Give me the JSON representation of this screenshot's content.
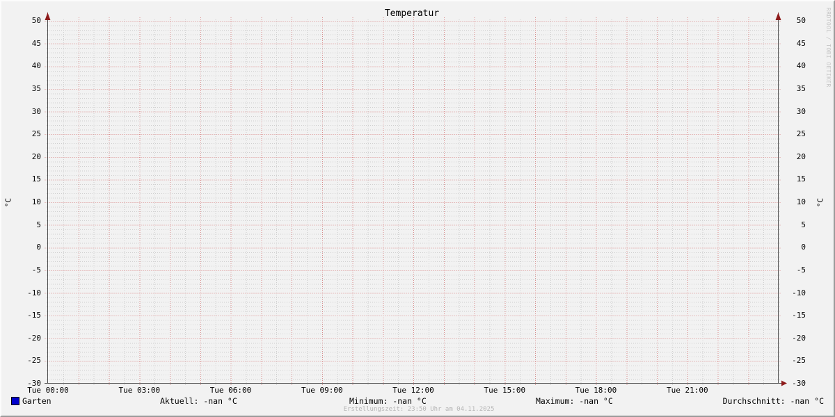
{
  "title": "Temperatur",
  "colors": {
    "background": "#f2f2f2",
    "grid_minor": "#cfcfcf",
    "grid_major": "#d98c8c",
    "axis": "#4e4e4e",
    "arrow": "#8e1b1b",
    "series_garten": "#0000cc",
    "text": "#000000",
    "footer_text": "#b5b5b5",
    "watermark_text": "#c5c5c5"
  },
  "chart_data": {
    "type": "line",
    "title": "Temperatur",
    "ylabel_left": "°C",
    "ylabel_right": "°C",
    "ylim": [
      -30,
      50
    ],
    "y_major_step": 5,
    "y_minor_step": 1,
    "x_hours": 24,
    "x_major_step_hours": 1,
    "x_minor_step_hours": 0.5,
    "grid": true,
    "legend_position": "bottom",
    "y_ticks": [
      {
        "value": 50,
        "label": "50"
      },
      {
        "value": 45,
        "label": "45"
      },
      {
        "value": 40,
        "label": "40"
      },
      {
        "value": 35,
        "label": "35"
      },
      {
        "value": 30,
        "label": "30"
      },
      {
        "value": 25,
        "label": "25"
      },
      {
        "value": 20,
        "label": "20"
      },
      {
        "value": 15,
        "label": "15"
      },
      {
        "value": 10,
        "label": "10"
      },
      {
        "value": 5,
        "label": "5"
      },
      {
        "value": 0,
        "label": "0"
      },
      {
        "value": -5,
        "label": "-5"
      },
      {
        "value": -10,
        "label": "-10"
      },
      {
        "value": -15,
        "label": "-15"
      },
      {
        "value": -20,
        "label": "-20"
      },
      {
        "value": -25,
        "label": "-25"
      },
      {
        "value": -30,
        "label": "-30"
      }
    ],
    "x_ticks": [
      {
        "hour": 0,
        "label": "Tue 00:00"
      },
      {
        "hour": 3,
        "label": "Tue 03:00"
      },
      {
        "hour": 6,
        "label": "Tue 06:00"
      },
      {
        "hour": 9,
        "label": "Tue 09:00"
      },
      {
        "hour": 12,
        "label": "Tue 12:00"
      },
      {
        "hour": 15,
        "label": "Tue 15:00"
      },
      {
        "hour": 18,
        "label": "Tue 18:00"
      },
      {
        "hour": 21,
        "label": "Tue 21:00"
      }
    ],
    "series": [
      {
        "name": "Garten",
        "color": "#0000cc",
        "values": [],
        "note": "no data plotted (all values NaN)"
      }
    ]
  },
  "legend": {
    "series_label": "Garten",
    "swatch_color": "#0000cc"
  },
  "stats": {
    "aktuell": "Aktuell: -nan °C",
    "minimum": "Minimum: -nan °C",
    "maximum": "Maximum: -nan °C",
    "durchschnitt": "Durchschnitt: -nan °C"
  },
  "footer": "Erstellungszeit: 23:50 Uhr am 04.11.2025",
  "watermark": "RRDTOOL / TOBI OETIKER"
}
